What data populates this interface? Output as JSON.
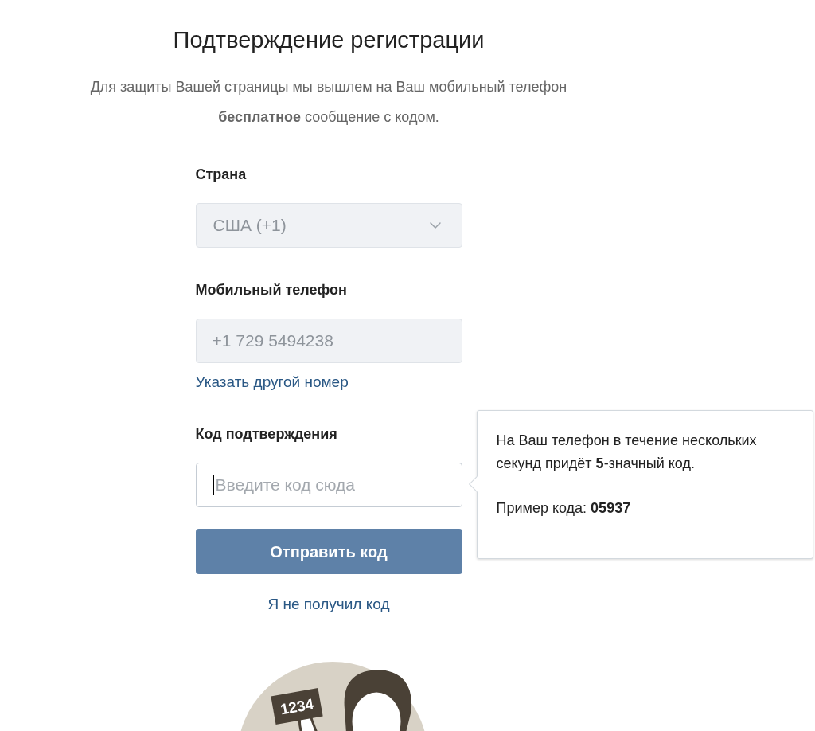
{
  "title": "Подтверждение регистрации",
  "intro": "Для защиты Вашей страницы мы вышлем на Ваш мобильный телефон **бесплатное** сообщение с кодом.",
  "fields": [
    {
      "kind": "select",
      "label": "Страна",
      "value": "США (+1)",
      "disabled": true
    },
    {
      "kind": "text",
      "label": "Мобильный телефон",
      "value": "+1 729 5494238",
      "disabled": true,
      "link": "Указать другой номер"
    },
    {
      "kind": "text",
      "label": "Код подтверждения",
      "placeholder": "Введите код сюда",
      "disabled": false,
      "focused": true
    }
  ],
  "submit_button": "Отправить код",
  "resend_link": "Я не получил код",
  "tooltip": {
    "paragraphs": [
      "На Ваш телефон в течение нескольких секунд придёт **5**-значный код.",
      "Пример кода: **05937**"
    ]
  },
  "illustration": {
    "sign_text": "1234"
  }
}
